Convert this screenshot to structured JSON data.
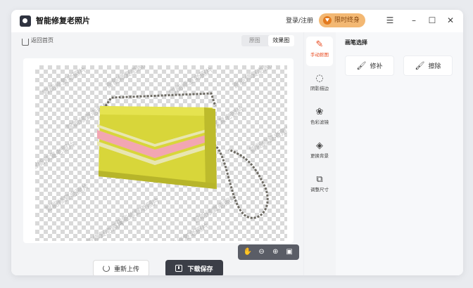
{
  "app": {
    "title": "智能修复老照片",
    "login_label": "登录/注册",
    "vip_label": "限时终身"
  },
  "window_controls": {
    "menu_icon": "menu-icon",
    "minimize_icon": "minimize-icon",
    "maximize_icon": "maximize-icon",
    "close_icon": "close-icon"
  },
  "nav": {
    "back_label": "返回首页"
  },
  "view_toggle": {
    "original_label": "原图",
    "result_label": "效果图",
    "selected": "效果图"
  },
  "watermark": {
    "text": "智能修复老照片"
  },
  "zoom_toolbar": {
    "icons": [
      "hand-icon",
      "zoom-out-icon",
      "zoom-in-icon",
      "fit-screen-icon"
    ]
  },
  "actions": {
    "reupload_label": "重新上传",
    "download_label": "下载保存"
  },
  "tools": [
    {
      "label": "手动抠图",
      "icon": "manual-cutout-icon",
      "active": true
    },
    {
      "label": "阴影描边",
      "icon": "shadow-outline-icon",
      "active": false
    },
    {
      "label": "色彩滤镜",
      "icon": "color-filter-icon",
      "active": false
    },
    {
      "label": "更换背景",
      "icon": "change-background-icon",
      "active": false
    },
    {
      "label": "调整尺寸",
      "icon": "resize-icon",
      "active": false
    }
  ],
  "brush_panel": {
    "title": "画笔选择",
    "repair_label": "修补",
    "erase_label": "擦除"
  },
  "colors": {
    "accent": "#e84a1f",
    "dark_button": "#3b3e47",
    "vip_bg": "#f3b873",
    "bag_yellow": "#d8d63a",
    "stripe_pink": "#f2a6b2"
  }
}
